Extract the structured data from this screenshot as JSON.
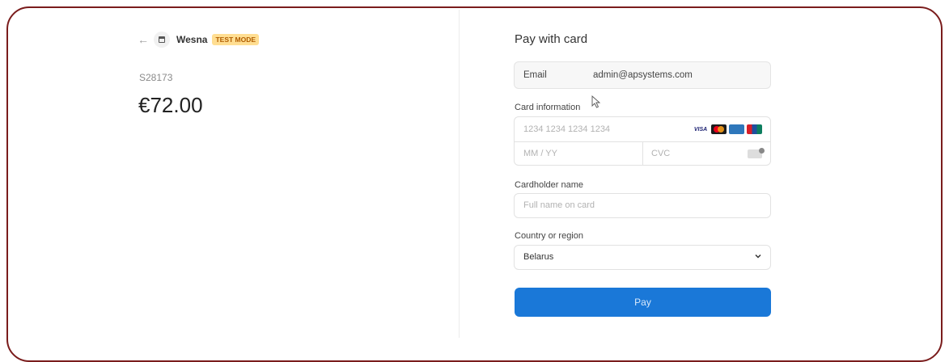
{
  "header": {
    "back_icon": "arrow-left-icon",
    "merchant": "Wesna",
    "mode_badge": "TEST MODE"
  },
  "order": {
    "id": "S28173",
    "amount": "€72.00"
  },
  "payment": {
    "title": "Pay with card",
    "email": {
      "label": "Email",
      "value": "admin@apsystems.com"
    },
    "card": {
      "label": "Card information",
      "number_placeholder": "1234 1234 1234 1234",
      "expiry_placeholder": "MM / YY",
      "cvc_placeholder": "CVC",
      "brands": [
        "VISA",
        "mastercard",
        "amex",
        "unionpay"
      ]
    },
    "cardholder": {
      "label": "Cardholder name",
      "placeholder": "Full name on card"
    },
    "country": {
      "label": "Country or region",
      "selected": "Belarus"
    },
    "pay_label": "Pay"
  },
  "colors": {
    "pay_button": "#1a78d8",
    "badge_bg": "#ffde92",
    "badge_text": "#b15d00",
    "frame": "#7a1c1c"
  }
}
